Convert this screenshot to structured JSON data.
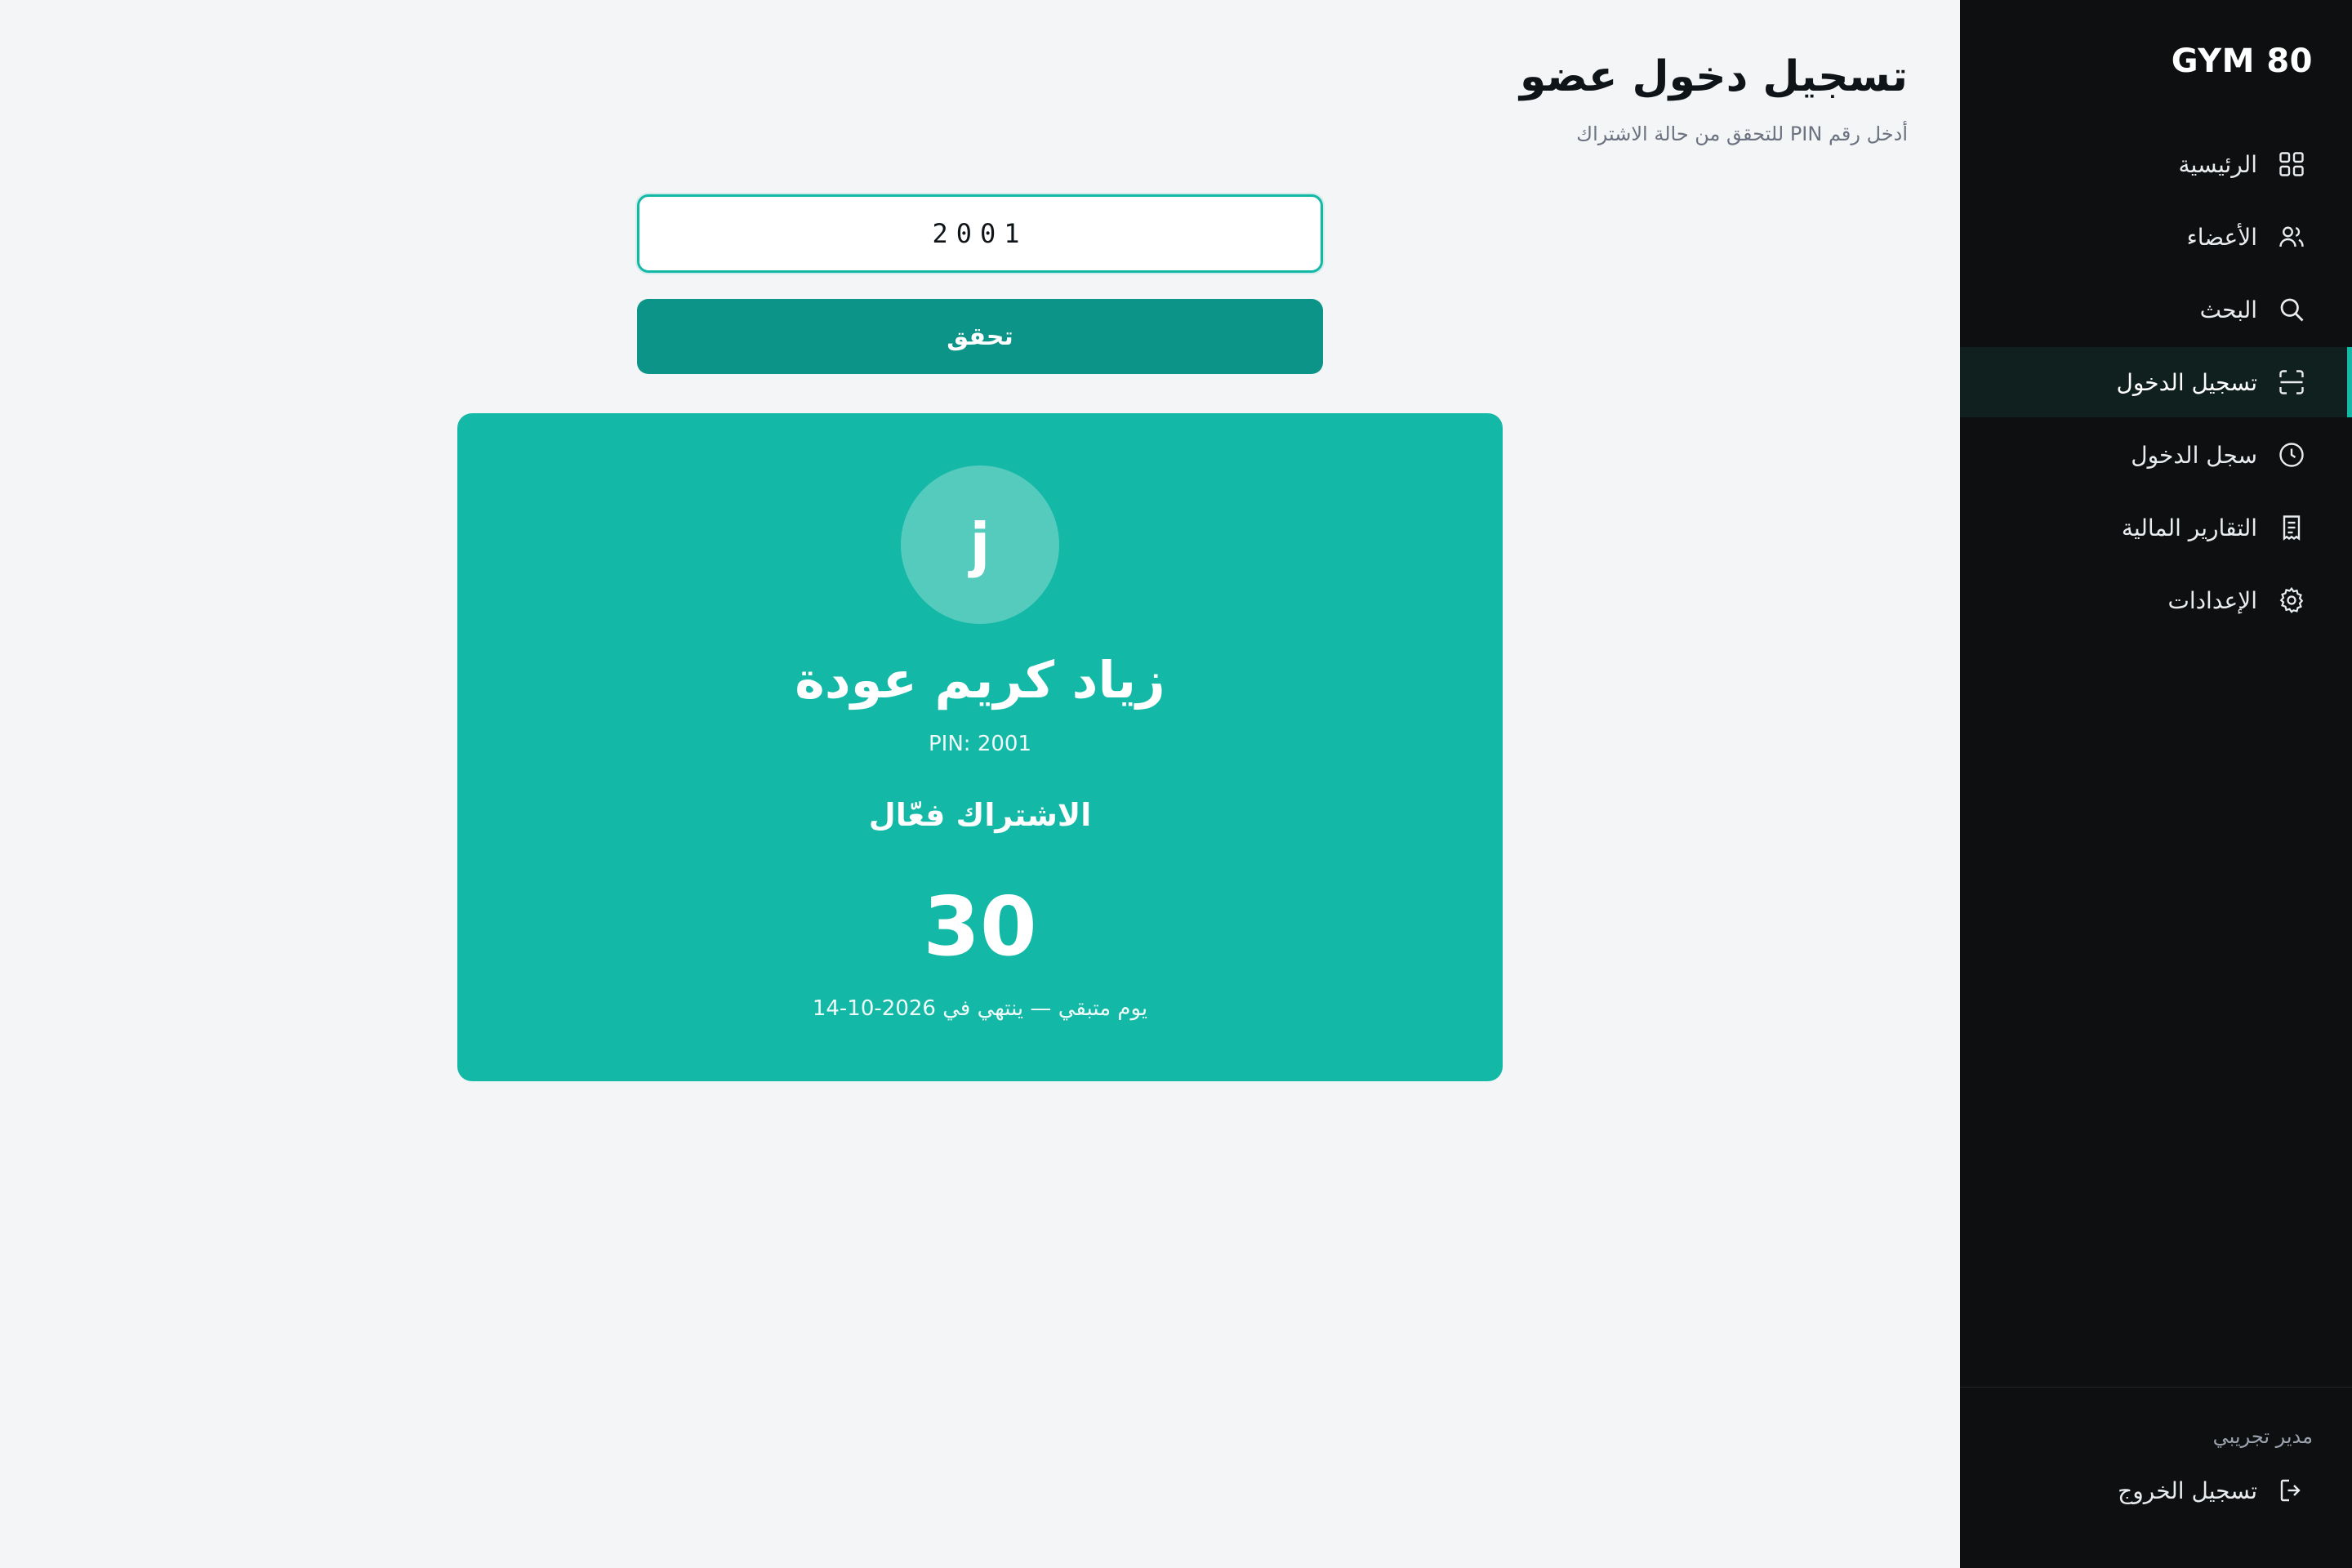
{
  "sidebar": {
    "brand": "GYM 80",
    "items": [
      {
        "label": "الرئيسية",
        "icon": "grid-icon",
        "active": false
      },
      {
        "label": "الأعضاء",
        "icon": "users-icon",
        "active": false
      },
      {
        "label": "البحث",
        "icon": "search-icon",
        "active": false
      },
      {
        "label": "تسجيل الدخول",
        "icon": "scan-icon",
        "active": true
      },
      {
        "label": "سجل الدخول",
        "icon": "clock-icon",
        "active": false
      },
      {
        "label": "التقارير المالية",
        "icon": "receipt-icon",
        "active": false
      },
      {
        "label": "الإعدادات",
        "icon": "gear-icon",
        "active": false
      }
    ],
    "user_name": "مدير تجريبي",
    "logout_label": "تسجيل الخروج"
  },
  "header": {
    "title": "تسجيل دخول عضو",
    "subtitle": "أدخل رقم PIN للتحقق من حالة الاشتراك"
  },
  "form": {
    "pin_value": "2001",
    "verify_label": "تحقق"
  },
  "result": {
    "avatar_initial": "j",
    "member_name": "زياد كريم عودة",
    "pin_line": "PIN: 2001",
    "status": "الاشتراك فعّال",
    "days_remaining": "30",
    "expiry_line": "يوم متبقي — ينتهي في 2026-10-14"
  },
  "colors": {
    "accent": "#14b8a6",
    "button": "#0d9488",
    "sidebar_bg": "#0d0f10",
    "page_bg": "#f4f5f7"
  }
}
